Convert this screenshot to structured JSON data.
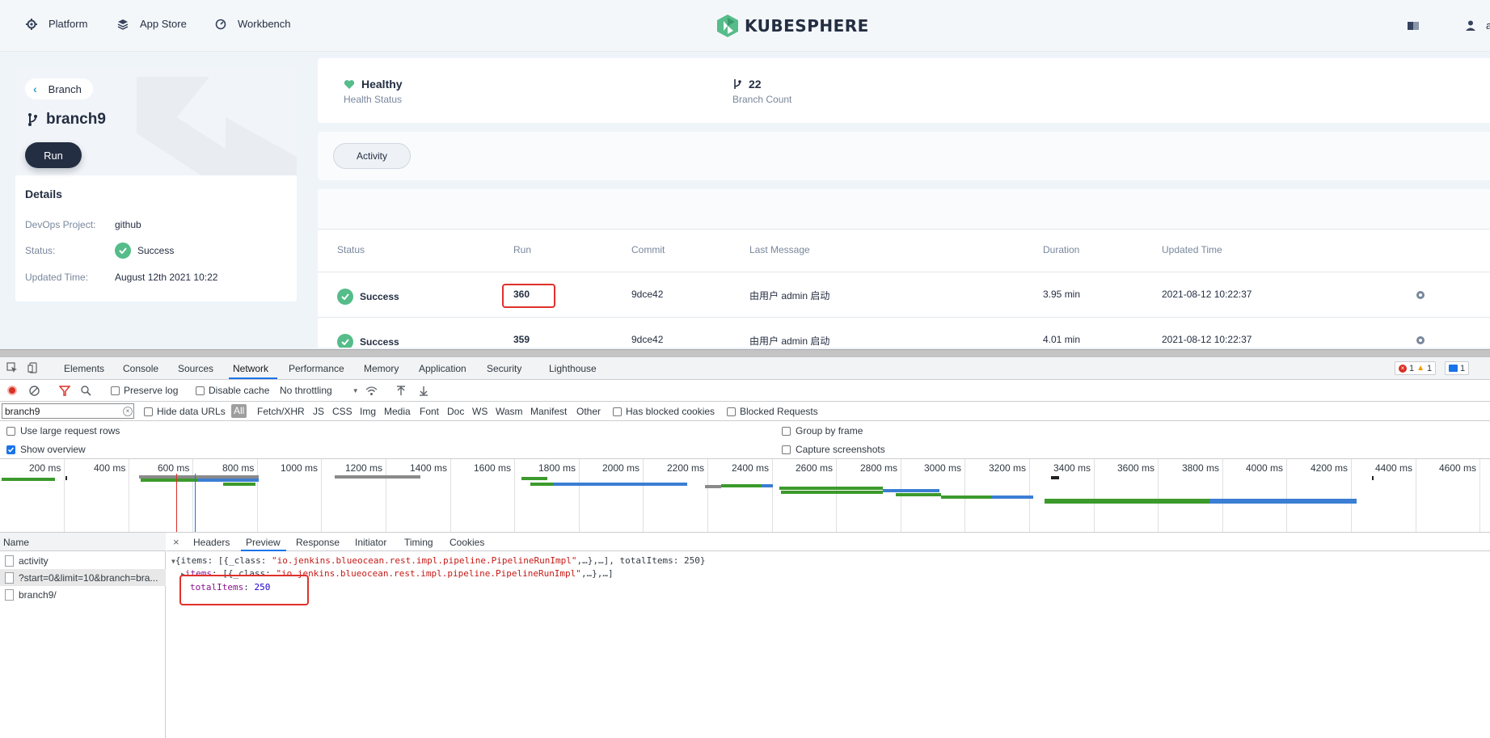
{
  "topnav": {
    "items": [
      {
        "label": "Platform",
        "icon": "gear-icon"
      },
      {
        "label": "App Store",
        "icon": "layers-icon"
      },
      {
        "label": "Workbench",
        "icon": "dashboard-icon"
      }
    ],
    "brand": "KUBESPHERE",
    "user_initial": "a"
  },
  "left": {
    "back_label": "Branch",
    "branch_name": "branch9",
    "run_label": "Run",
    "details_title": "Details",
    "details": [
      {
        "key": "DevOps Project:",
        "value": "github"
      },
      {
        "key": "Status:",
        "value": "Success"
      },
      {
        "key": "Updated Time:",
        "value": "August 12th 2021 10:22"
      }
    ]
  },
  "stats": {
    "health_value": "Healthy",
    "health_label": "Health Status",
    "branch_count_value": "22",
    "branch_count_label": "Branch Count"
  },
  "tabs": {
    "activity": "Activity"
  },
  "table": {
    "headers": [
      "Status",
      "Run",
      "Commit",
      "Last Message",
      "Duration",
      "Updated Time"
    ],
    "rows": [
      {
        "status": "Success",
        "run": "360",
        "commit": "9dce42",
        "message": "由用户 admin 启动",
        "duration": "3.95 min",
        "updated": "2021-08-12 10:22:37"
      },
      {
        "status": "Success",
        "run": "359",
        "commit": "9dce42",
        "message": "由用户 admin 启动",
        "duration": "4.01 min",
        "updated": "2021-08-12 10:22:37"
      }
    ]
  },
  "devtools": {
    "tabs": [
      "Elements",
      "Console",
      "Sources",
      "Network",
      "Performance",
      "Memory",
      "Application",
      "Security",
      "Lighthouse"
    ],
    "active_tab": "Network",
    "errors": "1",
    "warnings": "1",
    "messages": "1",
    "toolbar": {
      "preserve_log": "Preserve log",
      "disable_cache": "Disable cache",
      "throttling": "No throttling"
    },
    "filter": {
      "value": "branch9",
      "hide_data_urls": "Hide data URLs",
      "all": "All",
      "types": [
        "Fetch/XHR",
        "JS",
        "CSS",
        "Img",
        "Media",
        "Font",
        "Doc",
        "WS",
        "Wasm",
        "Manifest",
        "Other"
      ],
      "has_blocked_cookies": "Has blocked cookies",
      "blocked_requests": "Blocked Requests"
    },
    "options": {
      "large_rows": "Use large request rows",
      "show_overview": "Show overview",
      "group_by_frame": "Group by frame",
      "capture_screenshots": "Capture screenshots"
    },
    "overview_ticks": [
      "200 ms",
      "400 ms",
      "600 ms",
      "800 ms",
      "1000 ms",
      "1200 ms",
      "1400 ms",
      "1600 ms",
      "1800 ms",
      "2000 ms",
      "2200 ms",
      "2400 ms",
      "2600 ms",
      "2800 ms",
      "3000 ms",
      "3200 ms",
      "3400 ms",
      "3600 ms",
      "3800 ms",
      "4000 ms",
      "4200 ms",
      "4400 ms",
      "4600 ms"
    ],
    "name_header": "Name",
    "requests": [
      "activity",
      "?start=0&limit=10&branch=bra...",
      "branch9/"
    ],
    "detail_tabs": [
      "Headers",
      "Preview",
      "Response",
      "Initiator",
      "Timing",
      "Cookies"
    ],
    "active_detail_tab": "Preview",
    "preview": {
      "line1_prefix": "{items: [{_class: ",
      "line1_str": "\"io.jenkins.blueocean.rest.impl.pipeline.PipelineRunImpl\"",
      "line1_suffix": ",…},…], totalItems: 250}",
      "line2_key": "items",
      "line2_prefix": ": [{_class: ",
      "line2_str": "\"io.jenkins.blueocean.rest.impl.pipeline.PipelineRunImpl\"",
      "line2_suffix": ",…},…]",
      "line3_key": "totalItems",
      "line3_sep": ": ",
      "line3_val": "250"
    }
  }
}
